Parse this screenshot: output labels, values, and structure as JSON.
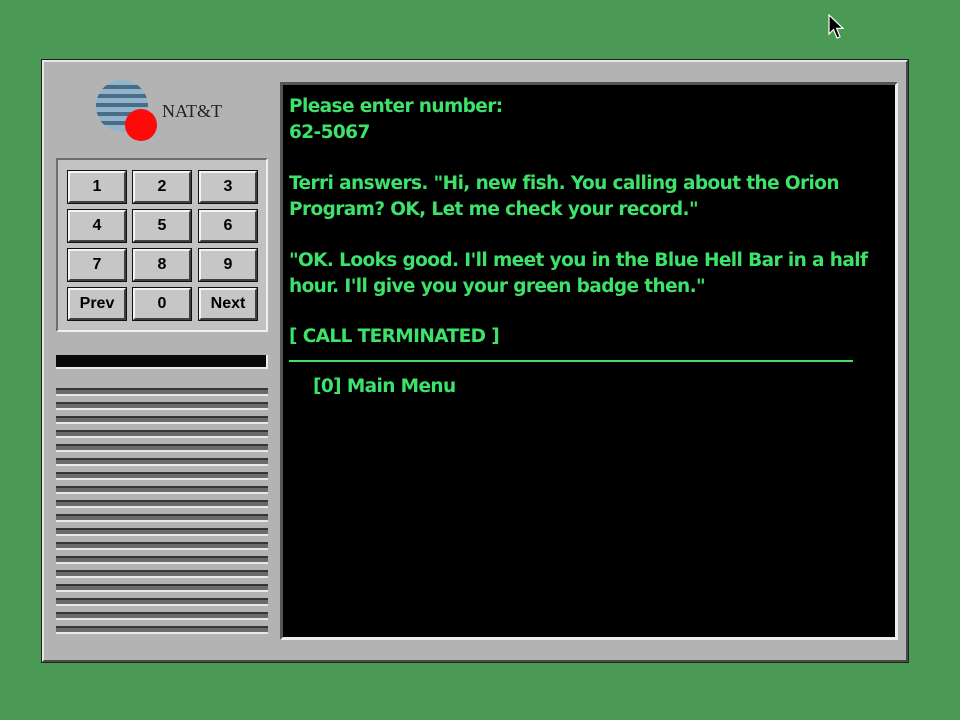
{
  "app": {
    "logo_text": "NAT&T"
  },
  "keypad": {
    "keys": [
      {
        "label": "1"
      },
      {
        "label": "2"
      },
      {
        "label": "3"
      },
      {
        "label": "4"
      },
      {
        "label": "5"
      },
      {
        "label": "6"
      },
      {
        "label": "7"
      },
      {
        "label": "8"
      },
      {
        "label": "9"
      },
      {
        "label": "Prev"
      },
      {
        "label": "0"
      },
      {
        "label": "Next"
      }
    ]
  },
  "screen": {
    "prompt": "Please enter number:",
    "number": "62-5067",
    "message1": [
      "Terri answers. \"Hi, new fish. You calling about the Orion",
      "Program? OK, Let me check your record.\""
    ],
    "message2": [
      "\"OK. Looks good. I'll meet you in the Blue Hell Bar in a half",
      "hour. I'll give you your green badge then.\""
    ],
    "status": "[ CALL TERMINATED ]",
    "menu_item": "[0] Main Menu"
  },
  "colors": {
    "desktop": "#4a9a56",
    "terminal_text": "#3ee26a",
    "terminal_bg": "#000000",
    "logo_dot": "#ff0000"
  },
  "icons": [
    "mouse-pointer-icon",
    "natt-logo-icon"
  ]
}
